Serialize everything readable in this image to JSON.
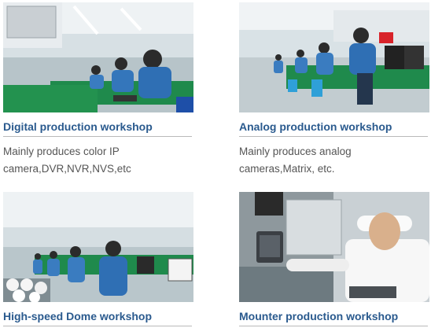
{
  "workshops": [
    {
      "title": "Digital production workshop",
      "description_line1": "Mainly produces color IP",
      "description_line2": "camera,DVR,NVR,NVS,etc",
      "photo_icon": "factory-workers-photo"
    },
    {
      "title": "Analog production workshop",
      "description_line1": "Mainly produces analog",
      "description_line2": "cameras,Matrix, etc.",
      "photo_icon": "factory-workers-photo"
    },
    {
      "title": "High-speed Dome workshop",
      "description_line1": "",
      "description_line2": "",
      "photo_icon": "factory-workers-photo"
    },
    {
      "title": "Mounter production workshop",
      "description_line1": "",
      "description_line2": "",
      "photo_icon": "technician-photo"
    }
  ],
  "colors": {
    "title": "#2a5a8e",
    "desc": "#555555",
    "rule": "#b9b9b9",
    "uniform": "#2f6fb4",
    "bench": "#1f8a4c"
  }
}
